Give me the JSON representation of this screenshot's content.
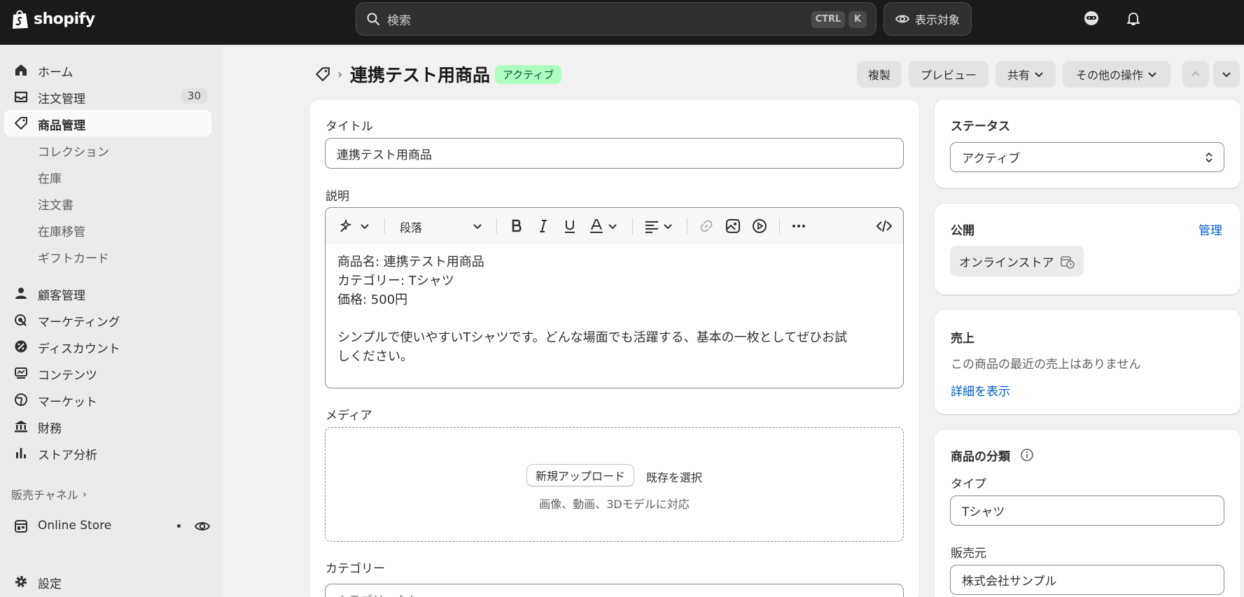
{
  "topbar": {
    "logo_text": "shopify",
    "search_placeholder": "検索",
    "kbd_ctrl": "CTRL",
    "kbd_k": "K",
    "view_label": "表示対象"
  },
  "sidebar": {
    "items": [
      {
        "label": "ホーム",
        "icon": "home-icon"
      },
      {
        "label": "注文管理",
        "icon": "inbox-icon",
        "count": "30"
      },
      {
        "label": "商品管理",
        "icon": "tag-icon"
      },
      {
        "label": "コレクション"
      },
      {
        "label": "在庫"
      },
      {
        "label": "注文書"
      },
      {
        "label": "在庫移管"
      },
      {
        "label": "ギフトカード"
      },
      {
        "label": "顧客管理",
        "icon": "person-icon"
      },
      {
        "label": "マーケティング",
        "icon": "target-icon"
      },
      {
        "label": "ディスカウント",
        "icon": "discount-icon"
      },
      {
        "label": "コンテンツ",
        "icon": "content-icon"
      },
      {
        "label": "マーケット",
        "icon": "globe-icon"
      },
      {
        "label": "財務",
        "icon": "bank-icon"
      },
      {
        "label": "ストア分析",
        "icon": "chart-icon"
      }
    ],
    "sales_channels_label": "販売チャネル",
    "online_store_label": "Online Store",
    "settings_label": "設定"
  },
  "header": {
    "title": "連携テスト用商品",
    "status": "アクティブ",
    "buttons": {
      "duplicate": "複製",
      "preview": "プレビュー",
      "share": "共有",
      "more_actions": "その他の操作"
    }
  },
  "main": {
    "title_label": "タイトル",
    "title_value": "連携テスト用商品",
    "description_label": "説明",
    "paragraph_label": "段落",
    "description_lines": [
      "商品名: 連携テスト用商品",
      "カテゴリー: Tシャツ",
      "価格: 500円",
      "シンプルで使いやすいTシャツです。どんな場面でも活躍する、基本の一枚としてぜひお試",
      "しください。"
    ],
    "media_label": "メディア",
    "upload_button": "新規アップロード",
    "select_existing": "既存を選択",
    "media_hint": "画像、動画、3Dモデルに対応",
    "category_label": "カテゴリー",
    "category_value": "カテゴリーなし"
  },
  "right": {
    "status_title": "ステータス",
    "status_value": "アクティブ",
    "publish_title": "公開",
    "publish_manage": "管理",
    "online_store_chip": "オンラインストア",
    "sales_title": "売上",
    "sales_text": "この商品の最近の売上はありません",
    "sales_link": "詳細を表示",
    "classification_title": "商品の分類",
    "type_label": "タイプ",
    "type_value": "Tシャツ",
    "vendor_label": "販売元",
    "vendor_value": "株式会社サンプル"
  },
  "colors": {
    "topbar": "#1a1a1a",
    "active_badge_bg": "#affebf",
    "active_badge_text": "#0c5132",
    "link": "#005bd3"
  }
}
